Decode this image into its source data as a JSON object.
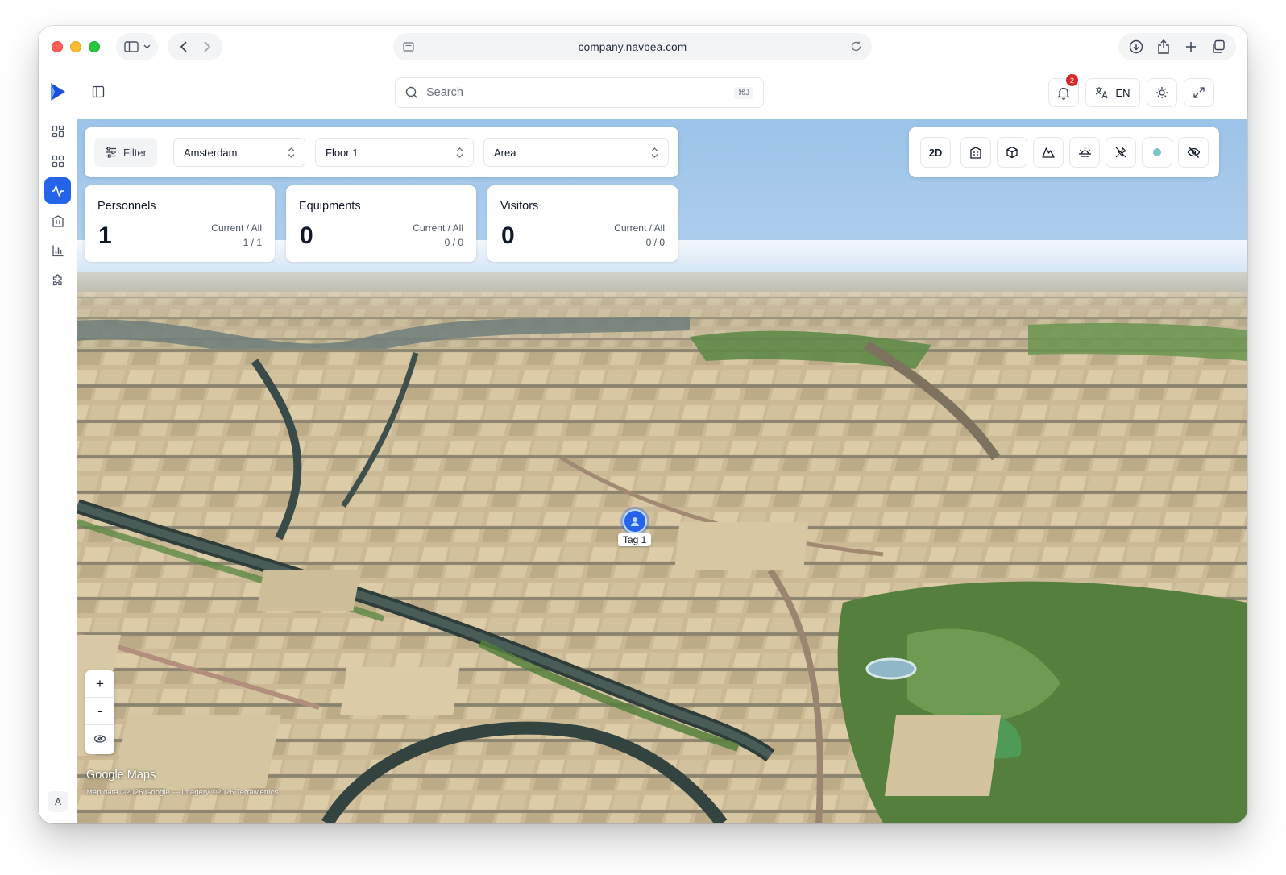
{
  "browser": {
    "url": "company.navbea.com"
  },
  "topbar": {
    "search_placeholder": "Search",
    "search_shortcut": "⌘J",
    "notification_count": "2",
    "language": "EN"
  },
  "sidebar": {
    "items": [
      {
        "icon": "dashboard-icon",
        "active": false
      },
      {
        "icon": "apps-grid-icon",
        "active": false
      },
      {
        "icon": "activity-icon",
        "active": true
      },
      {
        "icon": "building-icon",
        "active": false
      },
      {
        "icon": "bar-chart-icon",
        "active": false
      },
      {
        "icon": "puzzle-icon",
        "active": false
      }
    ],
    "avatar_initial": "A"
  },
  "filters": {
    "filter_label": "Filter",
    "city": "Amsterdam",
    "floor": "Floor 1",
    "area": "Area"
  },
  "stats": [
    {
      "title": "Personnels",
      "count": "1",
      "label": "Current / All",
      "value": "1 / 1"
    },
    {
      "title": "Equipments",
      "count": "0",
      "label": "Current / All",
      "value": "0 / 0"
    },
    {
      "title": "Visitors",
      "count": "0",
      "label": "Current / All",
      "value": "0 / 0"
    }
  ],
  "map_tools": {
    "mode_2d": "2D",
    "icons": [
      "building-view-icon",
      "cube-icon",
      "terrain-icon",
      "sunrise-icon",
      "no-pin-icon",
      "dot-icon",
      "eye-off-icon"
    ],
    "dot_color": "#7cc4c8"
  },
  "map": {
    "zoom_in": "+",
    "zoom_out": "-",
    "brand": "Google Maps",
    "attribution": "Map data ©2026 Google — Imagery ©2026 TerraMetrics",
    "tag_label": "Tag 1"
  },
  "colors": {
    "accent": "#2563eb",
    "badge": "#dc2626"
  }
}
